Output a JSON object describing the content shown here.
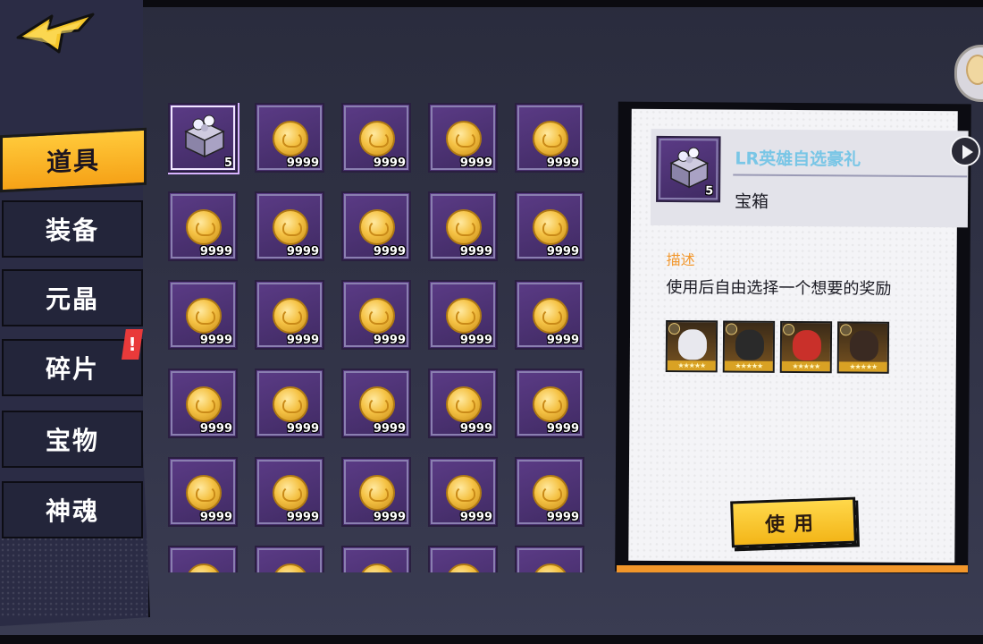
{
  "sidebar": {
    "tabs": [
      {
        "label": "道具",
        "active": true
      },
      {
        "label": "装备",
        "active": false
      },
      {
        "label": "元晶",
        "active": false
      },
      {
        "label": "碎片",
        "active": false,
        "badge": "!"
      },
      {
        "label": "宝物",
        "active": false
      },
      {
        "label": "神魂",
        "active": false
      }
    ]
  },
  "grid": {
    "items": [
      {
        "type": "chest",
        "qty": "5",
        "selected": true
      },
      {
        "type": "coin",
        "qty": "9999"
      },
      {
        "type": "coin",
        "qty": "9999"
      },
      {
        "type": "coin",
        "qty": "9999"
      },
      {
        "type": "coin",
        "qty": "9999"
      },
      {
        "type": "coin",
        "qty": "9999"
      },
      {
        "type": "coin",
        "qty": "9999"
      },
      {
        "type": "coin",
        "qty": "9999"
      },
      {
        "type": "coin",
        "qty": "9999"
      },
      {
        "type": "coin",
        "qty": "9999"
      },
      {
        "type": "coin",
        "qty": "9999"
      },
      {
        "type": "coin",
        "qty": "9999"
      },
      {
        "type": "coin",
        "qty": "9999"
      },
      {
        "type": "coin",
        "qty": "9999"
      },
      {
        "type": "coin",
        "qty": "9999"
      },
      {
        "type": "coin",
        "qty": "9999"
      },
      {
        "type": "coin",
        "qty": "9999"
      },
      {
        "type": "coin",
        "qty": "9999"
      },
      {
        "type": "coin",
        "qty": "9999"
      },
      {
        "type": "coin",
        "qty": "9999"
      },
      {
        "type": "coin",
        "qty": "9999"
      },
      {
        "type": "coin",
        "qty": "9999"
      },
      {
        "type": "coin",
        "qty": "9999"
      },
      {
        "type": "coin",
        "qty": "9999"
      },
      {
        "type": "coin",
        "qty": "9999"
      },
      {
        "type": "coin",
        "qty": ""
      },
      {
        "type": "coin",
        "qty": ""
      },
      {
        "type": "coin",
        "qty": ""
      },
      {
        "type": "coin",
        "qty": ""
      },
      {
        "type": "coin",
        "qty": ""
      }
    ]
  },
  "detail": {
    "item_name": "LR英雄自选豪礼",
    "item_qty": "5",
    "item_type": "宝箱",
    "desc_label": "描述",
    "desc_text": "使用后自由选择一个想要的奖励",
    "use_label": "使用",
    "rewards": [
      {
        "name": "hero-white-hair",
        "face_color": "#e8e8ee"
      },
      {
        "name": "hero-black-hair",
        "face_color": "#2a2a2a"
      },
      {
        "name": "hero-red-hair",
        "face_color": "#c9302a"
      },
      {
        "name": "hero-dark-hair",
        "face_color": "#3a2a22"
      }
    ]
  },
  "colors": {
    "accent": "#f6a217",
    "item_name": "#79c6e6",
    "desc_label": "#f2962a"
  }
}
